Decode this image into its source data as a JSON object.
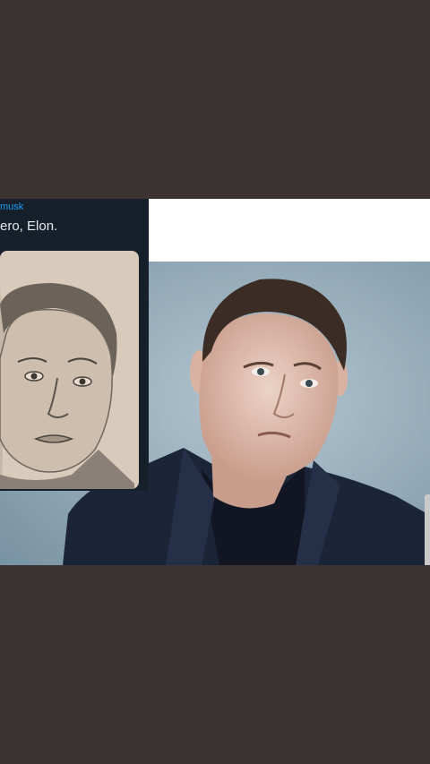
{
  "tweet": {
    "handle": "musk",
    "text": "ero, Elon."
  },
  "colors": {
    "background": "#3b3331",
    "tweet_bg": "#15202b",
    "handle": "#1d9bf0",
    "photo_bg": "#8fa7b5"
  }
}
